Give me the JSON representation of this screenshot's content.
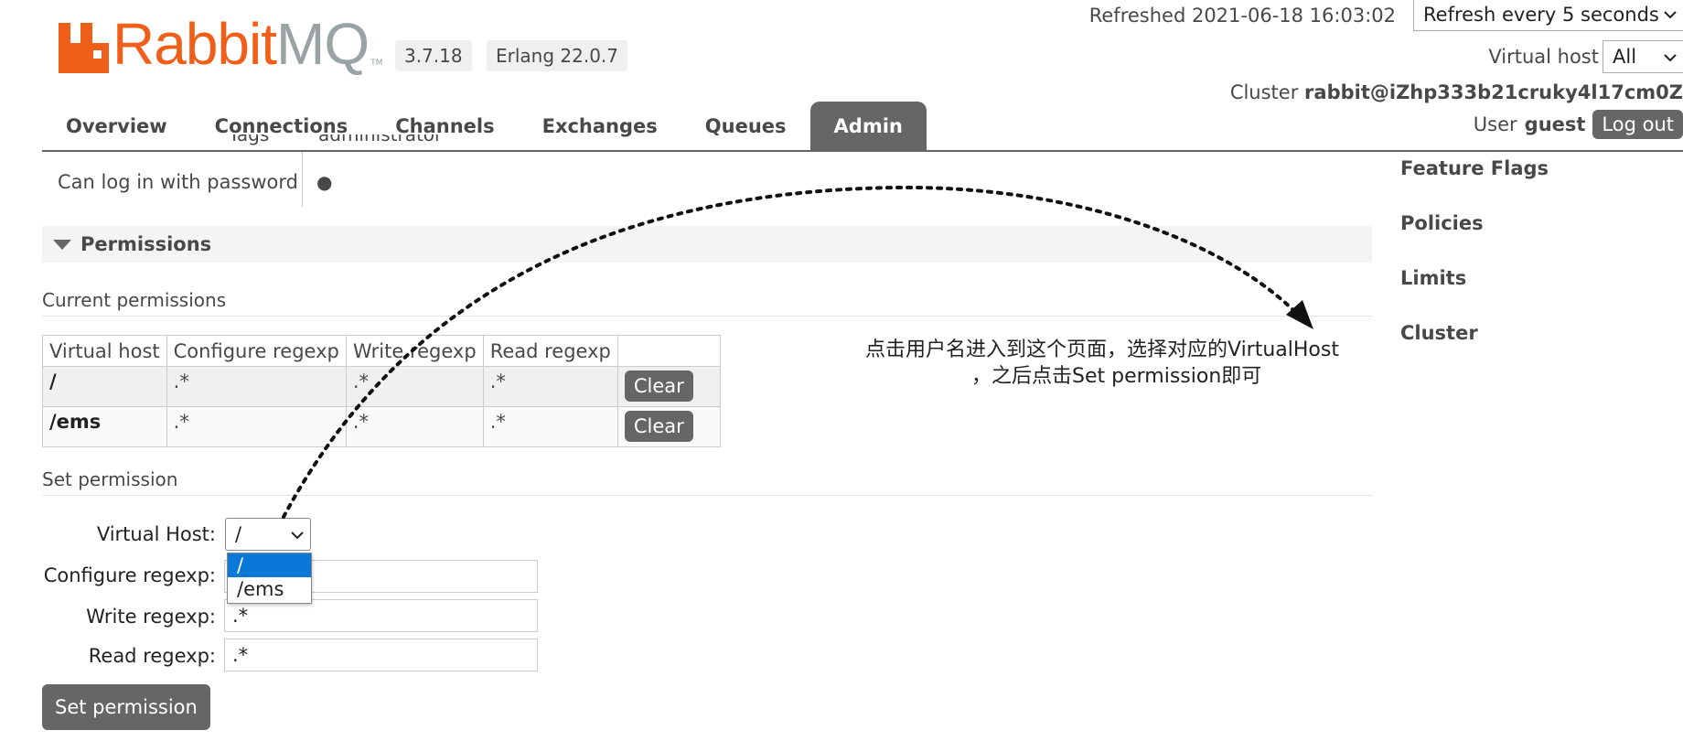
{
  "header": {
    "logo": {
      "brand": "Rabbit",
      "brand_accent": "MQ",
      "tm": "TM"
    },
    "version": "3.7.18",
    "erlang": "Erlang 22.0.7",
    "refreshed": "Refreshed 2021-06-18 16:03:02",
    "refresh_select": "Refresh every 5 seconds",
    "virtual_host_label": "Virtual host",
    "virtual_host_value": "All",
    "cluster_label": "Cluster",
    "cluster_value": "rabbit@iZhp333b21cruky4l17cm0Z",
    "user_label": "User",
    "user_value": "guest",
    "logout": "Log out"
  },
  "nav": {
    "tabs": [
      {
        "label": "Overview"
      },
      {
        "label": "Connections"
      },
      {
        "label": "Channels"
      },
      {
        "label": "Exchanges"
      },
      {
        "label": "Queues"
      },
      {
        "label": "Admin"
      }
    ],
    "active": "Admin"
  },
  "side_menu": {
    "items": [
      {
        "label": "Feature Flags"
      },
      {
        "label": "Policies"
      },
      {
        "label": "Limits"
      },
      {
        "label": "Cluster"
      }
    ]
  },
  "user_details": {
    "tags_label": "Tags",
    "tags_value": "administrator",
    "login_label": "Can log in with password",
    "login_value": "●"
  },
  "permissions": {
    "section_title": "Permissions",
    "current_title": "Current permissions",
    "columns": [
      "Virtual host",
      "Configure regexp",
      "Write regexp",
      "Read regexp",
      ""
    ],
    "rows": [
      {
        "vhost": "/",
        "configure": ".*",
        "write": ".*",
        "read": ".*",
        "action": "Clear"
      },
      {
        "vhost": "/ems",
        "configure": ".*",
        "write": ".*",
        "read": ".*",
        "action": "Clear"
      }
    ]
  },
  "set_permission": {
    "title": "Set permission",
    "virtual_host_label": "Virtual Host:",
    "virtual_host_value": "/",
    "virtual_host_options": [
      "/",
      "/ems"
    ],
    "configure_label": "Configure regexp:",
    "configure_value": "",
    "write_label": "Write regexp:",
    "write_value": ".*",
    "read_label": "Read regexp:",
    "read_value": ".*",
    "submit": "Set permission"
  },
  "annotation": {
    "line1": "点击用户名进入到这个页面，选择对应的VirtualHost",
    "line2": "，之后点击Set permission即可"
  },
  "colors": {
    "brand_orange": "#f05f1a",
    "brand_grey": "#9aa3a3",
    "button_grey": "#666666",
    "select_highlight": "#0a78d8"
  }
}
